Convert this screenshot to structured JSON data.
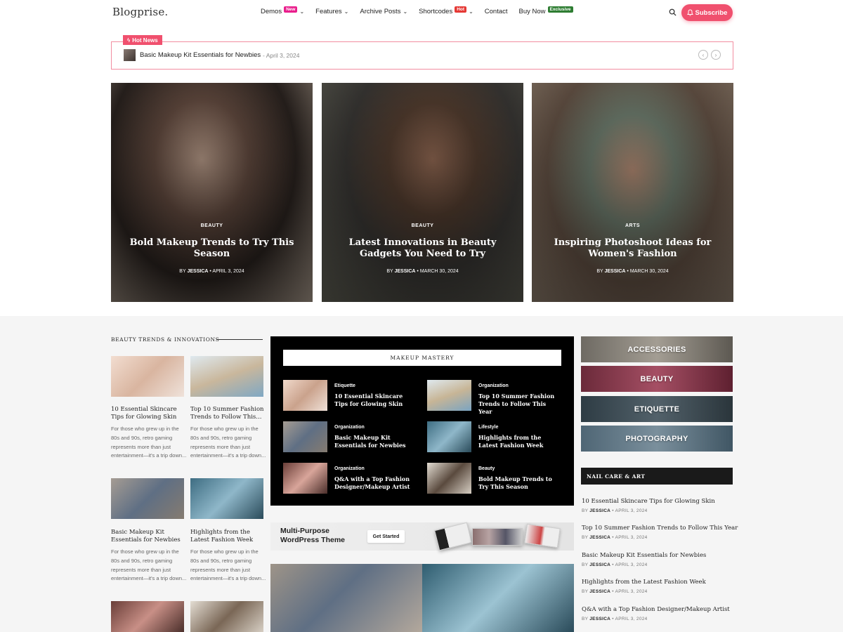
{
  "header": {
    "logo": "Blogprise.",
    "nav": [
      {
        "label": "Demos",
        "badge": "New",
        "has_dropdown": true
      },
      {
        "label": "Features",
        "badge": "",
        "has_dropdown": true
      },
      {
        "label": "Archive Posts",
        "badge": "",
        "has_dropdown": true
      },
      {
        "label": "Shortcodes",
        "badge": "Hot",
        "has_dropdown": true
      },
      {
        "label": "Contact",
        "badge": "",
        "has_dropdown": false
      },
      {
        "label": "Buy Now",
        "badge": "Exclusive",
        "has_dropdown": false
      }
    ],
    "subscribe_label": "Subscribe",
    "accent": "#f0506e"
  },
  "hot_news": {
    "tag": "Hot News",
    "title": "Basic Makeup Kit Essentials for Newbies",
    "date": "April 3, 2024"
  },
  "hero": [
    {
      "category": "BEAUTY",
      "title": "Bold Makeup Trends to Try This Season",
      "by": "BY",
      "author": "JESSICA",
      "date": "APRIL 3, 2024"
    },
    {
      "category": "BEAUTY",
      "title": "Latest Innovations in Beauty Gadgets You Need to Try",
      "by": "BY",
      "author": "JESSICA",
      "date": "MARCH 30, 2024"
    },
    {
      "category": "ARTS",
      "title": "Inspiring Photoshoot Ideas for Women's Fashion",
      "by": "BY",
      "author": "JESSICA",
      "date": "MARCH 30, 2024"
    }
  ],
  "left_section": {
    "heading": "BEAUTY TRENDS & INNOVATIONS",
    "posts": [
      {
        "title": "10 Essential Skincare Tips for Glowing Skin",
        "excerpt": "For those who grew up in the 80s and 90s, retro gaming represents more than just entertainment—it's a trip down..."
      },
      {
        "title": "Top 10 Summer Fashion Trends to Follow This...",
        "excerpt": "For those who grew up in the 80s and 90s, retro gaming represents more than just entertainment—it's a trip down..."
      },
      {
        "title": "Basic Makeup Kit Essentials for Newbies",
        "excerpt": "For those who grew up in the 80s and 90s, retro gaming represents more than just entertainment—it's a trip down..."
      },
      {
        "title": "Highlights from the Latest Fashion Week",
        "excerpt": "For those who grew up in the 80s and 90s, retro gaming represents more than just entertainment—it's a trip down..."
      }
    ]
  },
  "makeup_mastery": {
    "heading": "MAKEUP MASTERY",
    "posts": [
      {
        "category": "Etiquette",
        "title": "10 Essential Skincare Tips for Glowing Skin"
      },
      {
        "category": "Organization",
        "title": "Top 10 Summer Fashion Trends to Follow This Year"
      },
      {
        "category": "Organization",
        "title": "Basic Makeup Kit Essentials for Newbies"
      },
      {
        "category": "Lifestyle",
        "title": "Highlights from the Latest Fashion Week"
      },
      {
        "category": "Organization",
        "title": "Q&A with a Top Fashion Designer/Makeup Artist"
      },
      {
        "category": "Beauty",
        "title": "Bold Makeup Trends to Try This Season"
      }
    ]
  },
  "promo": {
    "title_line1": "Multi-Purpose",
    "title_line2": "WordPress Theme",
    "button": "Get Started"
  },
  "categories": [
    "ACCESSORIES",
    "BEAUTY",
    "ETIQUETTE",
    "PHOTOGRAPHY"
  ],
  "nail_care": {
    "heading": "NAIL CARE & ART",
    "posts": [
      {
        "title": "10 Essential Skincare Tips for Glowing Skin",
        "by": "BY",
        "author": "JESSICA",
        "date": "APRIL 3, 2024"
      },
      {
        "title": "Top 10 Summer Fashion Trends to Follow This Year",
        "by": "BY",
        "author": "JESSICA",
        "date": "APRIL 3, 2024"
      },
      {
        "title": "Basic Makeup Kit Essentials for Newbies",
        "by": "BY",
        "author": "JESSICA",
        "date": "APRIL 3, 2024"
      },
      {
        "title": "Highlights from the Latest Fashion Week",
        "by": "BY",
        "author": "JESSICA",
        "date": "APRIL 3, 2024"
      },
      {
        "title": "Q&A with a Top Fashion Designer/Makeup Artist",
        "by": "BY",
        "author": "JESSICA",
        "date": "APRIL 3, 2024"
      }
    ]
  }
}
